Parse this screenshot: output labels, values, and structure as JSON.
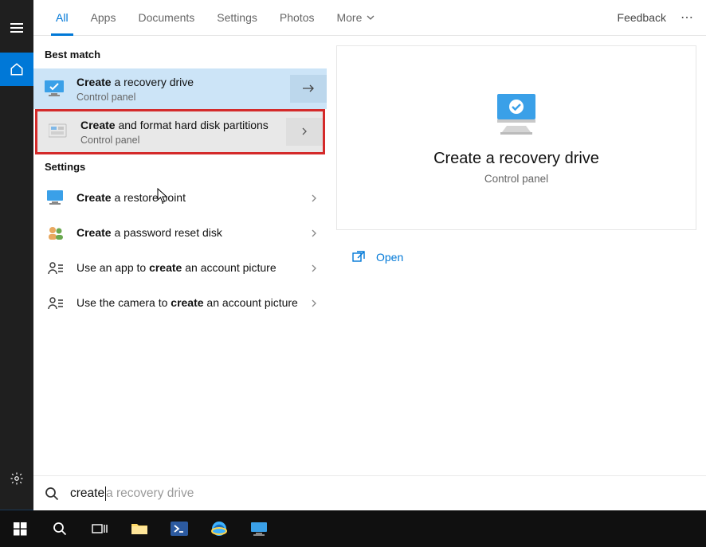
{
  "tabs": {
    "all": "All",
    "apps": "Apps",
    "documents": "Documents",
    "settings": "Settings",
    "photos": "Photos",
    "more": "More"
  },
  "topbar": {
    "feedback": "Feedback"
  },
  "groups": {
    "best_match": "Best match",
    "settings": "Settings"
  },
  "results": {
    "recovery": {
      "bold": "Create",
      "rest": " a recovery drive",
      "sub": "Control panel"
    },
    "partitions": {
      "bold": "Create",
      "rest": " and format hard disk partitions",
      "sub": "Control panel"
    }
  },
  "settings_items": [
    {
      "pre": "",
      "bold": "Create",
      "rest": " a restore point",
      "icon": "monitor"
    },
    {
      "pre": "",
      "bold": "Create",
      "rest": " a password reset disk",
      "icon": "users"
    },
    {
      "pre": "Use an app to ",
      "bold": "create",
      "rest": " an account picture",
      "icon": "person"
    },
    {
      "pre": "Use the camera to ",
      "bold": "create",
      "rest": " an account picture",
      "icon": "person"
    }
  ],
  "preview": {
    "title": "Create a recovery drive",
    "subtitle": "Control panel",
    "open": "Open"
  },
  "search": {
    "typed": "create",
    "ghost": " a recovery drive"
  }
}
